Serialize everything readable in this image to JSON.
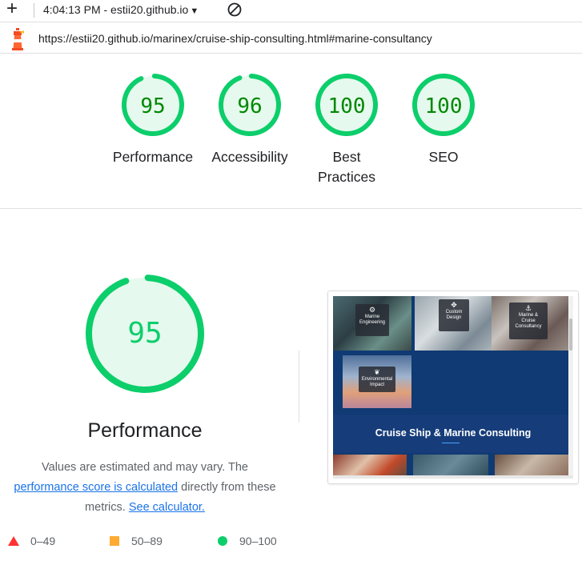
{
  "toolbar": {
    "time_origin": "4:04:13 PM - estii20.github.io",
    "caret": "▼"
  },
  "url": "https://estii20.github.io/marinex/cruise-ship-consulting.html#marine-consultancy",
  "gauges": [
    {
      "score": "95",
      "value": 95,
      "label": "Performance"
    },
    {
      "score": "96",
      "value": 96,
      "label": "Accessibility"
    },
    {
      "score": "100",
      "value": 100,
      "label_line1": "Best",
      "label_line2": "Practices"
    },
    {
      "score": "100",
      "value": 100,
      "label": "SEO"
    }
  ],
  "performance": {
    "score": "95",
    "value": 95,
    "title": "Performance",
    "desc_1": "Values are estimated and may vary. The",
    "link_1": "performance score is calculated",
    "desc_2": "directly from these",
    "desc_3": "metrics.",
    "link_2": "See calculator."
  },
  "legend": [
    {
      "range": "0–49",
      "color": "#ff3333",
      "shape": "triangle"
    },
    {
      "range": "50–89",
      "color": "#ffaa33",
      "shape": "square"
    },
    {
      "range": "90–100",
      "color": "#0cce6b",
      "shape": "circle"
    }
  ],
  "thumbnail": {
    "tiles": [
      {
        "label_1": "Marine",
        "label_2": "Engineering",
        "icon": "gears-icon"
      },
      {
        "label_1": "Custom",
        "label_2": "Design",
        "icon": "compass-icon"
      },
      {
        "label_1": "Marine &",
        "label_2": "Cruise",
        "label_3": "Consultancy",
        "icon": "anchor-icon"
      },
      {
        "label_1": "Environmental",
        "label_2": "Impact",
        "icon": "leaf-icon"
      }
    ],
    "hero_title": "Cruise Ship & Marine Consulting"
  },
  "colors": {
    "pass": "#0cce6b",
    "pass_text": "#008800",
    "pass_bg": "#e6f9ee",
    "link": "#1a73e8"
  }
}
